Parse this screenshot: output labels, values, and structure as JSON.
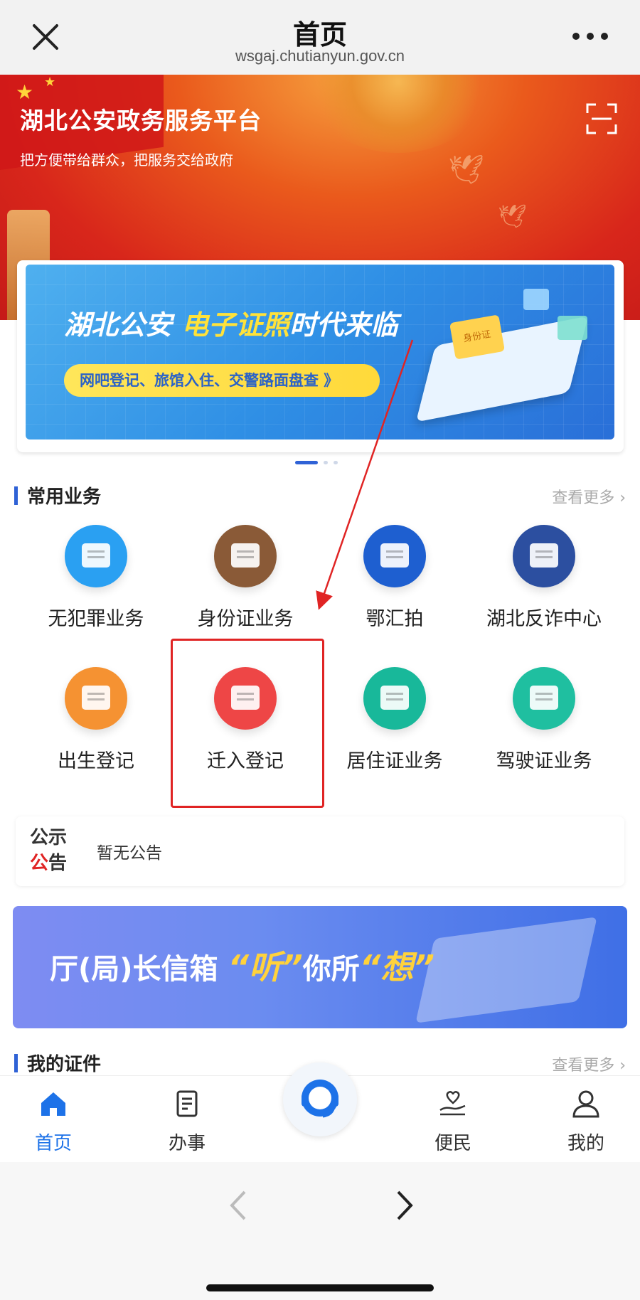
{
  "topnav": {
    "title": "首页",
    "url": "wsgaj.chutianyun.gov.cn"
  },
  "hero": {
    "title": "湖北公安政务服务平台",
    "subtitle": "把方便带给群众，把服务交给政府"
  },
  "banner": {
    "title_a": "湖北公安 ",
    "title_hl": "电子证照",
    "title_b": "时代来临",
    "pill": "网吧登记、旅馆入住、交警路面盘查 》",
    "card_label": "身份证",
    "active_slide": 1,
    "total_slides": 3
  },
  "common": {
    "heading": "常用业务",
    "more": "查看更多 ›",
    "items": [
      {
        "label": "无犯罪业务",
        "icon": "id-card-icon",
        "color": "#2aa0f2"
      },
      {
        "label": "身份证业务",
        "icon": "id-card-portrait-icon",
        "color": "#8a5a37"
      },
      {
        "label": "鄂汇拍",
        "icon": "phone-camera-icon",
        "color": "#1e5fd0"
      },
      {
        "label": "湖北反诈中心",
        "icon": "police-shield-icon",
        "color": "#2c4fa0"
      },
      {
        "label": "出生登记",
        "icon": "edit-form-icon",
        "color": "#f59232"
      },
      {
        "label": "迁入登记",
        "icon": "transfer-document-icon",
        "color": "#ee4646"
      },
      {
        "label": "居住证业务",
        "icon": "residence-card-icon",
        "color": "#18b89a"
      },
      {
        "label": "驾驶证业务",
        "icon": "driving-license-icon",
        "color": "#1fbfa0"
      }
    ]
  },
  "notice": {
    "tag_top": "公示",
    "tag_bottom_red": "公",
    "tag_bottom": "告",
    "message": "暂无公告"
  },
  "mailbox": {
    "text_a": "厅(局)长信箱 ",
    "q1": "“听”",
    "text_b": "你所",
    "q2": "“想”"
  },
  "my_docs": {
    "heading": "我的证件",
    "more": "查看更多 ›"
  },
  "tabbar": {
    "items": [
      {
        "label": "首页",
        "icon": "home-icon",
        "active": true
      },
      {
        "label": "办事",
        "icon": "document-icon",
        "active": false
      },
      {
        "label": "便民",
        "icon": "hand-heart-icon",
        "active": false
      },
      {
        "label": "我的",
        "icon": "user-icon",
        "active": false
      }
    ],
    "center_icon": "customer-service-icon"
  },
  "colors": {
    "accent": "#1d72e8",
    "highlight_box": "#e02424"
  }
}
